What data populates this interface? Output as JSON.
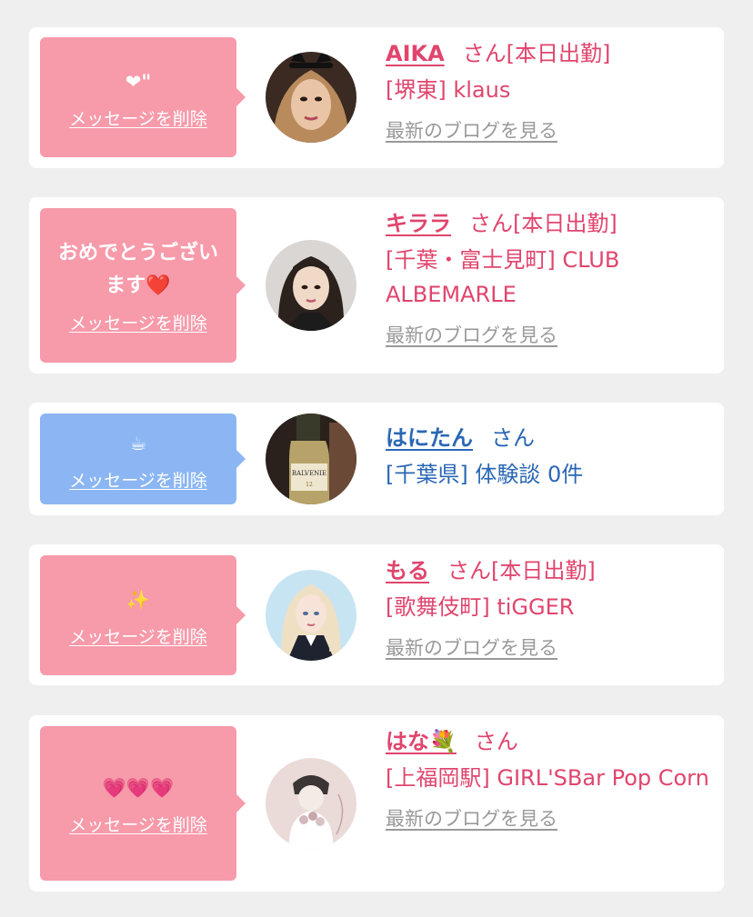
{
  "cards": [
    {
      "message": "❤\"",
      "delete_label": "メッセージを削除",
      "name": "AIKA",
      "suffix": "さん[本日出勤]",
      "location_shop": "[堺東] klaus",
      "blog_link": "最新のブログを見る"
    },
    {
      "message": "おめでとうございます❤️",
      "delete_label": "メッセージを削除",
      "name": "キララ",
      "suffix": "さん[本日出勤]",
      "location_shop": "[千葉・富士見町] CLUB ALBEMARLE",
      "blog_link": "最新のブログを見る"
    },
    {
      "message": "☕",
      "delete_label": "メッセージを削除",
      "name": "はにたん",
      "suffix": "さん",
      "location_shop": "[千葉県] 体験談 0件"
    },
    {
      "message": "✨",
      "delete_label": "メッセージを削除",
      "name": "もる",
      "suffix": "さん[本日出勤]",
      "location_shop": "[歌舞伎町] tiGGER",
      "blog_link": "最新のブログを見る"
    },
    {
      "message": "💗💗💗",
      "delete_label": "メッセージを削除",
      "name": "はな💐",
      "suffix": "さん",
      "location_shop": "[上福岡駅] GIRL'SBar Pop Corn",
      "blog_link": "最新のブログを見る"
    }
  ],
  "colors": {
    "accent_pink": "#e0456d",
    "accent_blue": "#2a67b5",
    "bubble_pink": "#f79aaa",
    "bubble_blue": "#8bb6f3"
  }
}
